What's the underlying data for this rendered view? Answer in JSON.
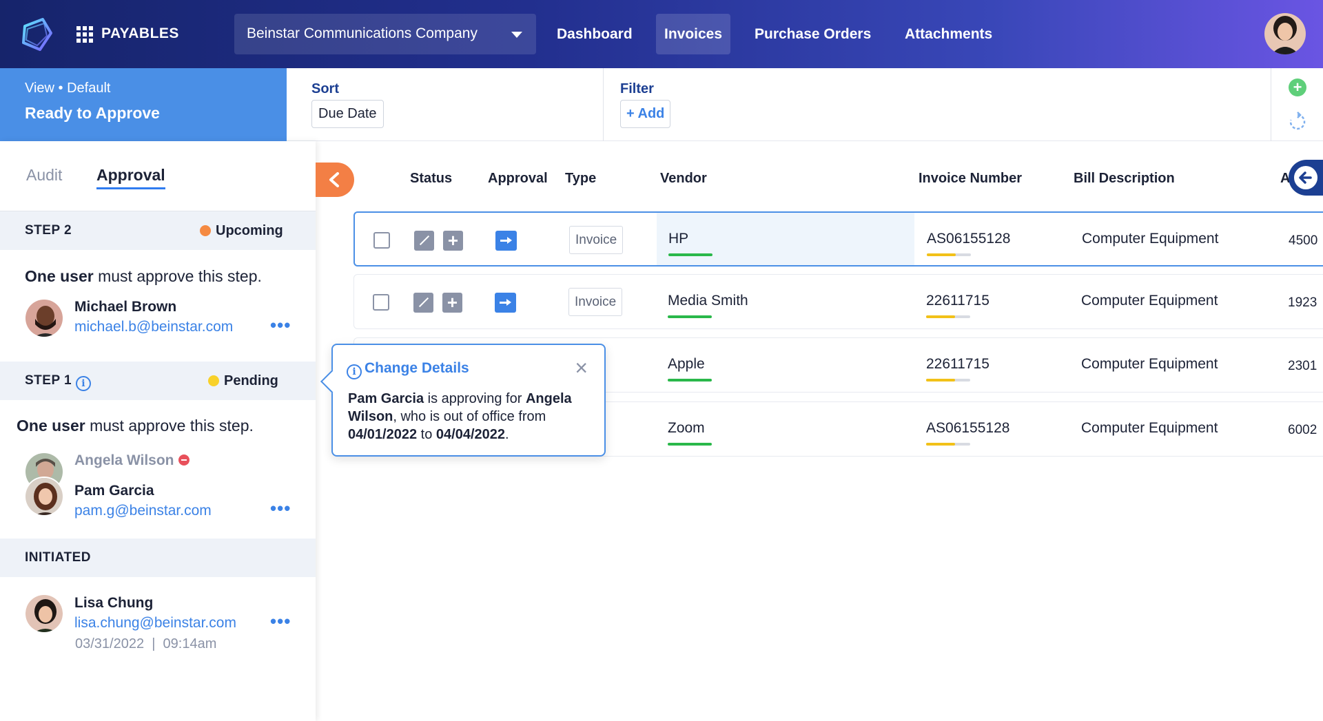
{
  "app": {
    "name": "PAYABLES",
    "company": "Beinstar Communications Company"
  },
  "nav": [
    "Dashboard",
    "Invoices",
    "Purchase Orders",
    "Attachments"
  ],
  "view": {
    "label": "View • Default",
    "title": "Ready to Approve"
  },
  "sort": {
    "label": "Sort",
    "value": "Due Date"
  },
  "filter": {
    "label": "Filter",
    "add": "+ Add"
  },
  "sidebar": {
    "tabs": [
      "Audit",
      "Approval"
    ],
    "step2": {
      "label": "STEP 2",
      "status": "Upcoming",
      "status_color": "#f58a42",
      "rule_bold": "One user",
      "rule_rest": " must approve this step.",
      "user": {
        "name": "Michael Brown",
        "email": "michael.b@beinstar.com"
      }
    },
    "step1": {
      "label": "STEP 1",
      "status": "Pending",
      "status_color": "#f8d12a",
      "rule_bold": "One user",
      "rule_rest": " must approve this step.",
      "original_user": {
        "name": "Angela Wilson"
      },
      "user": {
        "name": "Pam Garcia",
        "email": "pam.g@beinstar.com"
      }
    },
    "initiated": {
      "label": "INITIATED",
      "user": {
        "name": "Lisa Chung",
        "email": "lisa.chung@beinstar.com",
        "date": "03/31/2022",
        "time": "09:14am"
      }
    },
    "more_icon": "•••"
  },
  "table": {
    "columns": [
      "Status",
      "Approval",
      "Type",
      "Vendor",
      "Invoice Number",
      "Bill Description",
      "A"
    ],
    "rows": [
      {
        "type": "Invoice",
        "vendor": "HP",
        "invoice_number": "AS06155128",
        "description": "Computer Equipment",
        "amount": "4500"
      },
      {
        "type": "Invoice",
        "vendor": "Media Smith",
        "invoice_number": "22611715",
        "description": "Computer Equipment",
        "amount": "1923"
      },
      {
        "type": "ce",
        "vendor": "Apple",
        "invoice_number": "22611715",
        "description": "Computer Equipment",
        "amount": "2301"
      },
      {
        "type": "ce",
        "vendor": "Zoom",
        "invoice_number": "AS06155128",
        "description": "Computer Equipment",
        "amount": "6002"
      }
    ]
  },
  "tooltip": {
    "title": "Change Details",
    "close": "×",
    "approver": "Pam Garcia",
    "text1": " is approving for ",
    "absent": "Angela Wilson",
    "text2": ", who is out of office from ",
    "from": "04/01/2022",
    "text3": " to ",
    "to": "04/04/2022",
    "text4": "."
  }
}
